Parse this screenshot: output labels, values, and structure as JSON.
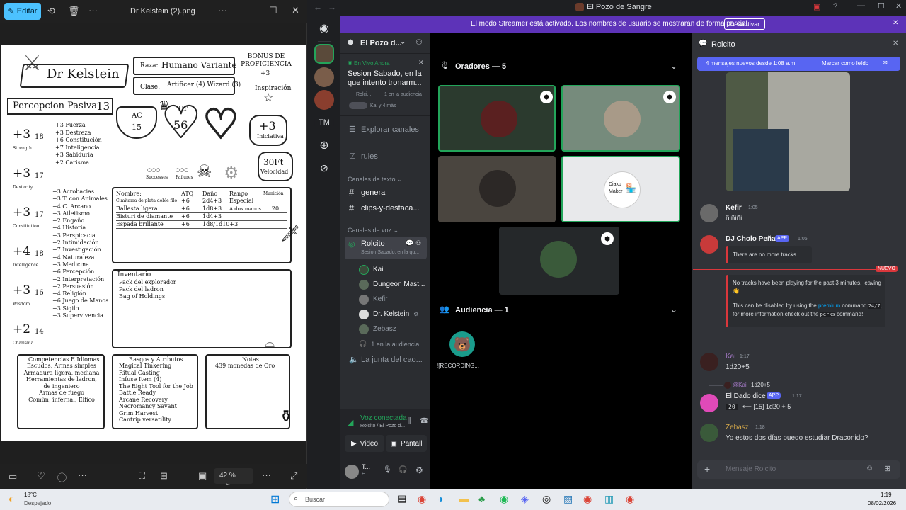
{
  "photos": {
    "edit_label": "Editar",
    "file_title": "Dr Kelstein (2).png",
    "zoom": "42 %",
    "sheet": {
      "name": "Dr Kelstein",
      "race_label": "Raza:",
      "race": "Humano Variante",
      "class_label": "Clase:",
      "class": "Artificer (4) Wizard (3)",
      "bonus_label": "BONUS DE PROFICIENCIA",
      "bonus": "+3",
      "inspiration": "Inspiración",
      "passive_label": "Percepcion Pasiva",
      "passive": "13",
      "ac_label": "AC",
      "ac": "15",
      "hp_label": "HP",
      "hp": "56",
      "init": "+3",
      "init_label": "Iniciativa",
      "speed": "30Ft",
      "speed_label": "Velocidad",
      "successes": "Successes",
      "failures": "Failures",
      "stats": [
        {
          "mod": "+3",
          "score": "18",
          "name": "Strength"
        },
        {
          "mod": "+3",
          "score": "17",
          "name": "Dexterity"
        },
        {
          "mod": "+3",
          "score": "17",
          "name": "Constitution"
        },
        {
          "mod": "+4",
          "score": "18",
          "name": "Intelligence"
        },
        {
          "mod": "+3",
          "score": "16",
          "name": "Wisdom"
        },
        {
          "mod": "+2",
          "score": "14",
          "name": "Charisma"
        }
      ],
      "saves": [
        "+3 Fuerza",
        "+3 Destreza",
        "+6 Constitución",
        "+7 Inteligencia",
        "+3 Sabiduría",
        "+2 Carisma"
      ],
      "skills": [
        "+3 Acrobacias",
        "+3 T. con Animales",
        "+4 C. Arcano",
        "+3 Atletismo",
        "+2 Engaño",
        "+4 Historia",
        "+3 Perspicacia",
        "+2 Intimidación",
        "+7 Investigación",
        "+4 Naturaleza",
        "+3 Medicina",
        "+6 Percepción",
        "+2 Interpretación",
        "+2 Persuasión",
        "+4 Religión",
        "+6 Juego de Manos",
        "+3 Sigilo",
        "+3 Supervivencia"
      ],
      "atk_headers": [
        "Nombre:",
        "ATQ",
        "Daño",
        "Rango",
        "Munición"
      ],
      "attacks": [
        [
          "Cimitarra de plata doble filo",
          "+6",
          "2d4+3",
          "Especial",
          ""
        ],
        [
          "Ballesta ligera",
          "+6",
          "1d8+3",
          "A dos manos",
          "20"
        ],
        [
          "Bisturi de diamante",
          "+6",
          "1d4+3",
          "",
          ""
        ],
        [
          "Espada brillante",
          "+6",
          "1d8/1d10+3",
          "",
          ""
        ]
      ],
      "inventory_label": "Inventario",
      "inventory": [
        "Pack del explorador",
        "Pack del ladron",
        "Bag of Holdings"
      ],
      "prof_label": "Competencias E Idiomas",
      "prof": [
        "Escudos, Armas simples",
        "Armadura ligera, mediana",
        "Herramientas de ladron, de ingeniero",
        "Armas de fuego",
        "Común, infernal, Elfico"
      ],
      "traits_label": "Rasgos y Atributos",
      "traits": [
        "Magical Tinkering",
        "Ritual Casting",
        "Infuse Item (4)",
        "The Right Tool for the Job",
        "Battle Ready",
        "Arcane Recovery",
        "Necromancy Savant",
        "Grim Harvest",
        "Cantrip versatility"
      ],
      "notes_label": "Notas",
      "notes": [
        "439 monedas de Oro"
      ]
    }
  },
  "discord": {
    "window_title": "El Pozo de Sangre",
    "streamer_banner": "El modo Streamer está activado. Los nombres de usuario se mostrarán de forma parcial.",
    "banner_button": "Desactivar",
    "server_name": "El Pozo d...",
    "servers": [
      {
        "label": "",
        "color": "#5a4a3a"
      },
      {
        "label": "",
        "color": "#7a5d4a"
      },
      {
        "label": "",
        "color": "#8a3e2e"
      },
      {
        "label": "TM",
        "color": "#1e1f22"
      }
    ],
    "live": {
      "badge": "En Vivo Ahora",
      "title": "Sesion Sabado, en la que intento tronarm...",
      "meta1": "Rolci...",
      "meta2": "1 en la audiencia",
      "meta3": "Kai y 4 más"
    },
    "browse": "Explorar canales",
    "rules": "rules",
    "text_category": "Canales de texto",
    "text_channels": [
      "general",
      "clips-y-destaca..."
    ],
    "voice_category": "Canales de voz",
    "stage": {
      "name": "Rolcito",
      "sub": "Sesion Sabado, en la qu..."
    },
    "voice_users": [
      {
        "name": "Kai",
        "bright": true
      },
      {
        "name": "Dungeon Mast...",
        "bright": true
      },
      {
        "name": "Kefir",
        "bright": false
      },
      {
        "name": "Dr. Kelstein",
        "bright": true
      },
      {
        "name": "Zebasz",
        "bright": false
      }
    ],
    "audience_count": "1 en la audiencia",
    "other_voice": "La junta del cao...",
    "voice_connected": "Voz conectada",
    "voice_sub": "Rolcito / El Pozo d...",
    "video_btn": "Video",
    "screen_btn": "Pantall",
    "user_short": "T...",
    "user_status": "E",
    "speakers_header": "Oradores — 5",
    "audience_header": "Audiencia — 1",
    "audience_user": "![RECORDING...",
    "diaku_line1": "Diaku",
    "diaku_line2": "Maker",
    "chat": {
      "channel": "Rolcito",
      "new_msgs": "4 mensajes nuevos desde 1:08 a.m.",
      "mark_read": "Marcar como leído",
      "messages": [
        {
          "author": "Kefir",
          "time": "1:05",
          "text": "ñiñiñi",
          "color": "#f2f3f5"
        },
        {
          "author": "DJ Cholo Peña",
          "app": "APP",
          "time": "1:05",
          "text": "",
          "color": "#f2f3f5"
        },
        {
          "author": "Kai",
          "time": "1:17",
          "text": "1d20+5",
          "color": "#a77bca"
        },
        {
          "author": "El Dado dice",
          "app": "APP",
          "time": "1:17",
          "text": "",
          "color": "#f2f3f5"
        },
        {
          "author": "Zebasz",
          "time": "1:18",
          "text": "Yo estos dos días puedo estudiar Draconido?",
          "color": "#d4a84a"
        }
      ],
      "embed1": "There are no more tracks",
      "new_badge": "NUEVO",
      "embed2_line1": "No tracks have been playing for the past 3 minutes, leaving 👋",
      "embed2_pre": "This can be disabled by using the",
      "embed2_premium": "premium",
      "embed2_cmd": "command",
      "embed2_code1": "24/7",
      "embed2_mid": ", for more information check out the",
      "embed2_code2": "perks",
      "embed2_end": "command!",
      "reply_user": "@Kai",
      "reply_text": "1d20+5",
      "dice_result": "20",
      "dice_text": "⟵ [15] 1d20 + 5",
      "input_placeholder": "Mensaje Rolcito"
    }
  },
  "taskbar": {
    "temp": "18°C",
    "weather": "Despejado",
    "search": "Buscar",
    "time": "1:19",
    "date": "08/02/2026"
  },
  "colors": {
    "accent": "#5865f2",
    "banner": "#5d33b8",
    "green": "#23a55a"
  }
}
